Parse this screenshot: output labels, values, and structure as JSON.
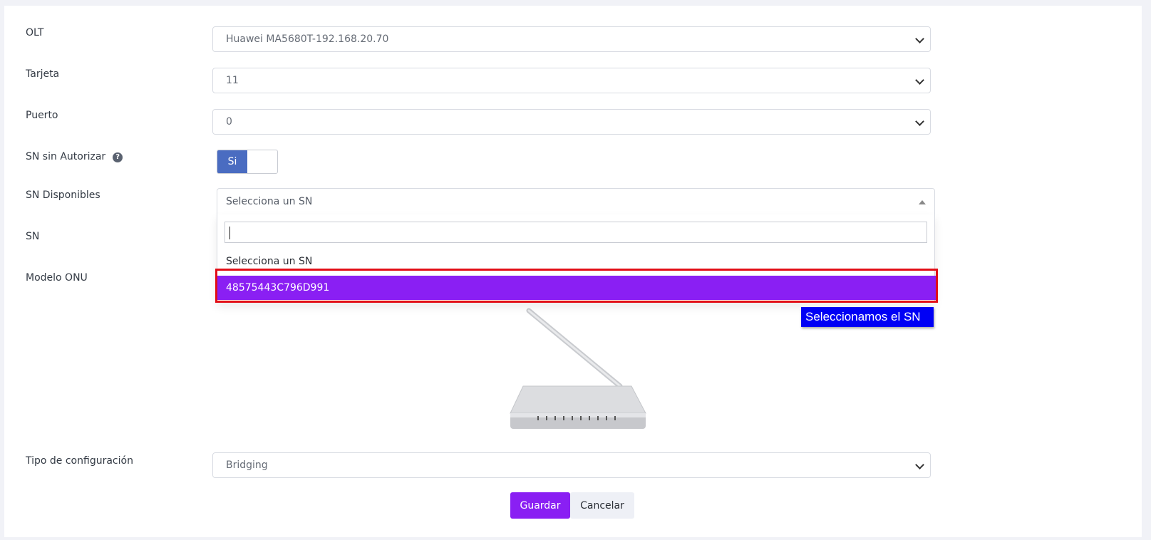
{
  "form": {
    "olt": {
      "label": "OLT",
      "value": "Huawei MA5680T-192.168.20.70"
    },
    "tarjeta": {
      "label": "Tarjeta",
      "value": "11"
    },
    "puerto": {
      "label": "Puerto",
      "value": "0"
    },
    "sn_sin_autorizar": {
      "label": "SN sin Autorizar",
      "help_icon": "question-circle-icon",
      "toggle_on_label": "Si"
    },
    "sn_disponibles": {
      "label": "SN Disponibles",
      "selected": "Selecciona un SN",
      "search_value": "",
      "options": [
        "Selecciona un SN",
        "48575443C796D991"
      ],
      "highlighted_option": "48575443C796D991"
    },
    "sn": {
      "label": "SN"
    },
    "modelo_onu": {
      "label": "Modelo ONU",
      "image": "onu-router-image"
    },
    "tipo_configuracion": {
      "label": "Tipo de configuración",
      "value": "Bridging"
    }
  },
  "annotation": {
    "callout_text": "Seleccionamos el SN",
    "callout_color": "#0000f5",
    "highlight_color": "#e20e17"
  },
  "actions": {
    "save_label": "Guardar",
    "cancel_label": "Cancelar"
  },
  "colors": {
    "accent": "#8a1ff3",
    "toggle": "#4a6cc1"
  }
}
